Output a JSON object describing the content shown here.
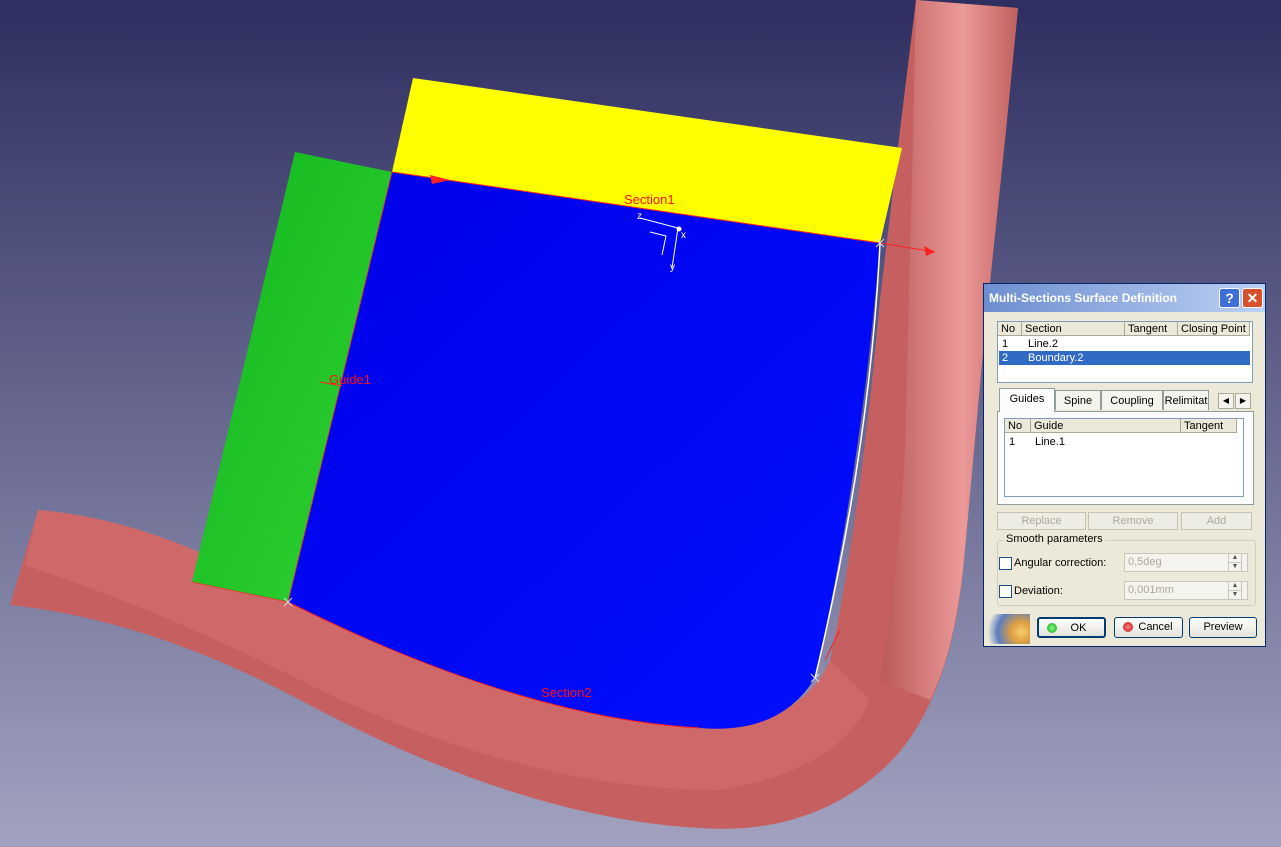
{
  "viewport": {
    "labels": {
      "section1": "Section1",
      "section2": "Section2",
      "guide1": "Guide1",
      "axis_x": "x",
      "axis_y": "y",
      "axis_z": "z"
    },
    "colors": {
      "background_top": "#2e2f60",
      "background_bottom": "#a2a2c0",
      "tube": "#c96060",
      "blue_surface": "#0000f0",
      "yellow_surface": "#ffff00",
      "green_surface": "#20c020",
      "label": "#ff1010"
    }
  },
  "dialog": {
    "title": "Multi-Sections Surface Definition",
    "help_icon": "?",
    "close_icon": "✕",
    "sections": {
      "columns": [
        "No",
        "Section",
        "Tangent",
        "Closing Point"
      ],
      "rows": [
        {
          "no": "1",
          "section": "Line.2"
        },
        {
          "no": "2",
          "section": "Boundary.2"
        }
      ]
    },
    "tabs": [
      "Guides",
      "Spine",
      "Coupling",
      "Relimitat"
    ],
    "guides": {
      "columns": [
        "No",
        "Guide",
        "Tangent"
      ],
      "rows": [
        {
          "no": "1",
          "guide": "Line.1"
        }
      ]
    },
    "buttons": {
      "replace": "Replace",
      "remove": "Remove",
      "add": "Add"
    },
    "smooth": {
      "title": "Smooth parameters",
      "angular_label": "Angular correction:",
      "angular_value": "0,5deg",
      "deviation_label": "Deviation:",
      "deviation_value": "0,001mm"
    },
    "footer": {
      "ok": "OK",
      "cancel": "Cancel",
      "preview": "Preview"
    },
    "colors": {
      "title_start": "#6d8ed0",
      "title_end": "#bcd0f3",
      "selection": "#316ac5"
    }
  }
}
